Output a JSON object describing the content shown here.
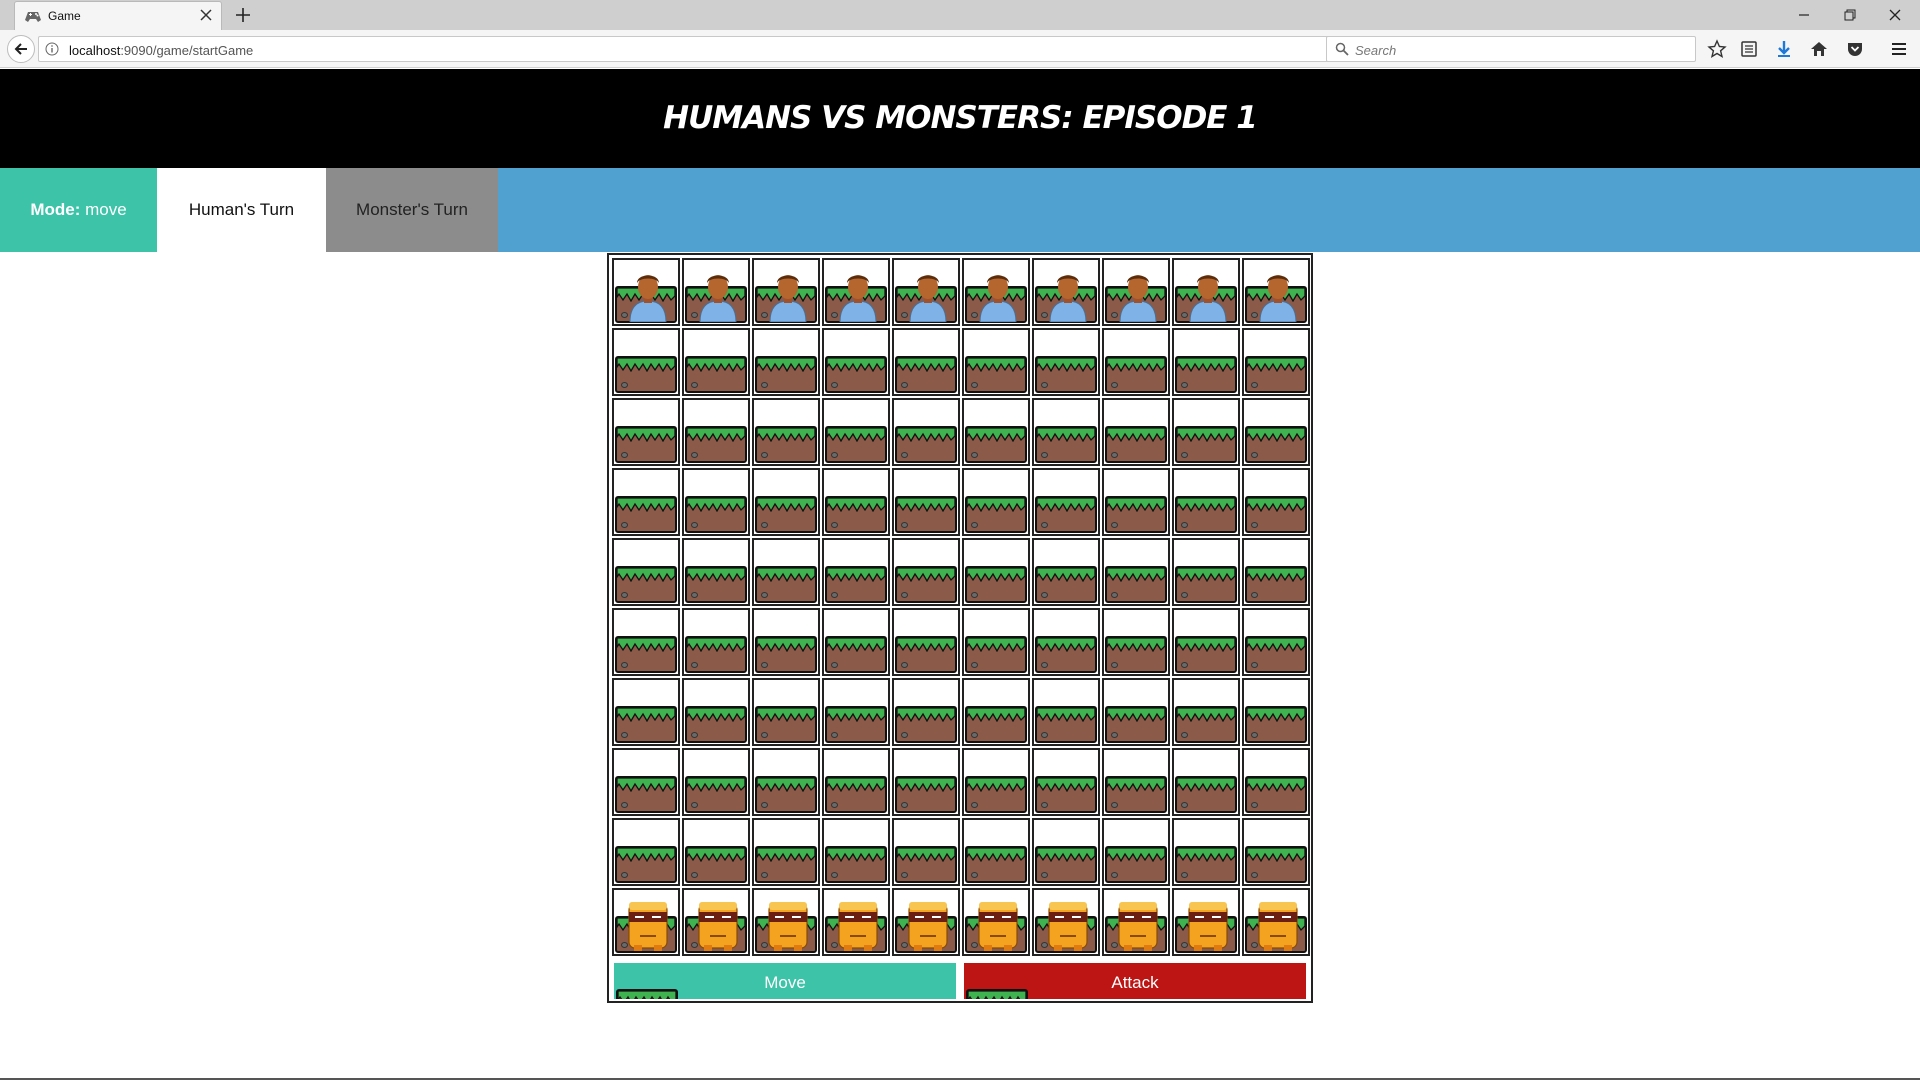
{
  "browser": {
    "tab_title": "Game",
    "url_host": "localhost",
    "url_rest": ":9090/game/startGame",
    "search_placeholder": "Search"
  },
  "page": {
    "title": "HUMANS VS MONSTERS: EPISODE 1",
    "mode_label": "Mode:",
    "mode_value": "move",
    "humans_turn": "Human's Turn",
    "monsters_turn": "Monster's Turn",
    "move_button": "Move",
    "attack_button": "Attack"
  },
  "board": {
    "rows": 10,
    "cols": 10,
    "cells": [
      [
        "human",
        "human",
        "human",
        "human",
        "human",
        "human",
        "human",
        "human",
        "human",
        "human"
      ],
      [
        "grass",
        "grass",
        "grass",
        "grass",
        "grass",
        "grass",
        "grass",
        "grass",
        "grass",
        "grass"
      ],
      [
        "grass",
        "grass",
        "grass",
        "grass",
        "grass",
        "grass",
        "grass",
        "grass",
        "grass",
        "grass"
      ],
      [
        "grass",
        "grass",
        "grass",
        "grass",
        "grass",
        "grass",
        "grass",
        "grass",
        "grass",
        "grass"
      ],
      [
        "grass",
        "grass",
        "grass",
        "grass",
        "grass",
        "grass",
        "grass",
        "grass",
        "grass",
        "grass"
      ],
      [
        "grass",
        "grass",
        "grass",
        "grass",
        "grass",
        "grass",
        "grass",
        "grass",
        "grass",
        "grass"
      ],
      [
        "grass",
        "grass",
        "grass",
        "grass",
        "grass",
        "grass",
        "grass",
        "grass",
        "grass",
        "grass"
      ],
      [
        "grass",
        "grass",
        "grass",
        "grass",
        "grass",
        "grass",
        "grass",
        "grass",
        "grass",
        "grass"
      ],
      [
        "grass",
        "grass",
        "grass",
        "grass",
        "grass",
        "grass",
        "grass",
        "grass",
        "grass",
        "grass"
      ],
      [
        "monster",
        "monster",
        "monster",
        "monster",
        "monster",
        "monster",
        "monster",
        "monster",
        "monster",
        "monster"
      ]
    ]
  },
  "colors": {
    "header_bg": "#000000",
    "menu_bg": "#50a0d0",
    "mode_bg": "#3cc3a8",
    "monsters_turn_bg": "#8c8c8c",
    "move_bg": "#3cc3a8",
    "attack_bg": "#bd1414",
    "grass": "#3fb34f",
    "dirt": "#8b5a48"
  },
  "icons": {
    "tab": "game-controller-icon",
    "human": "human-avatar-icon",
    "monster": "orange-monster-icon",
    "tile": "grass-dirt-tile-icon"
  }
}
